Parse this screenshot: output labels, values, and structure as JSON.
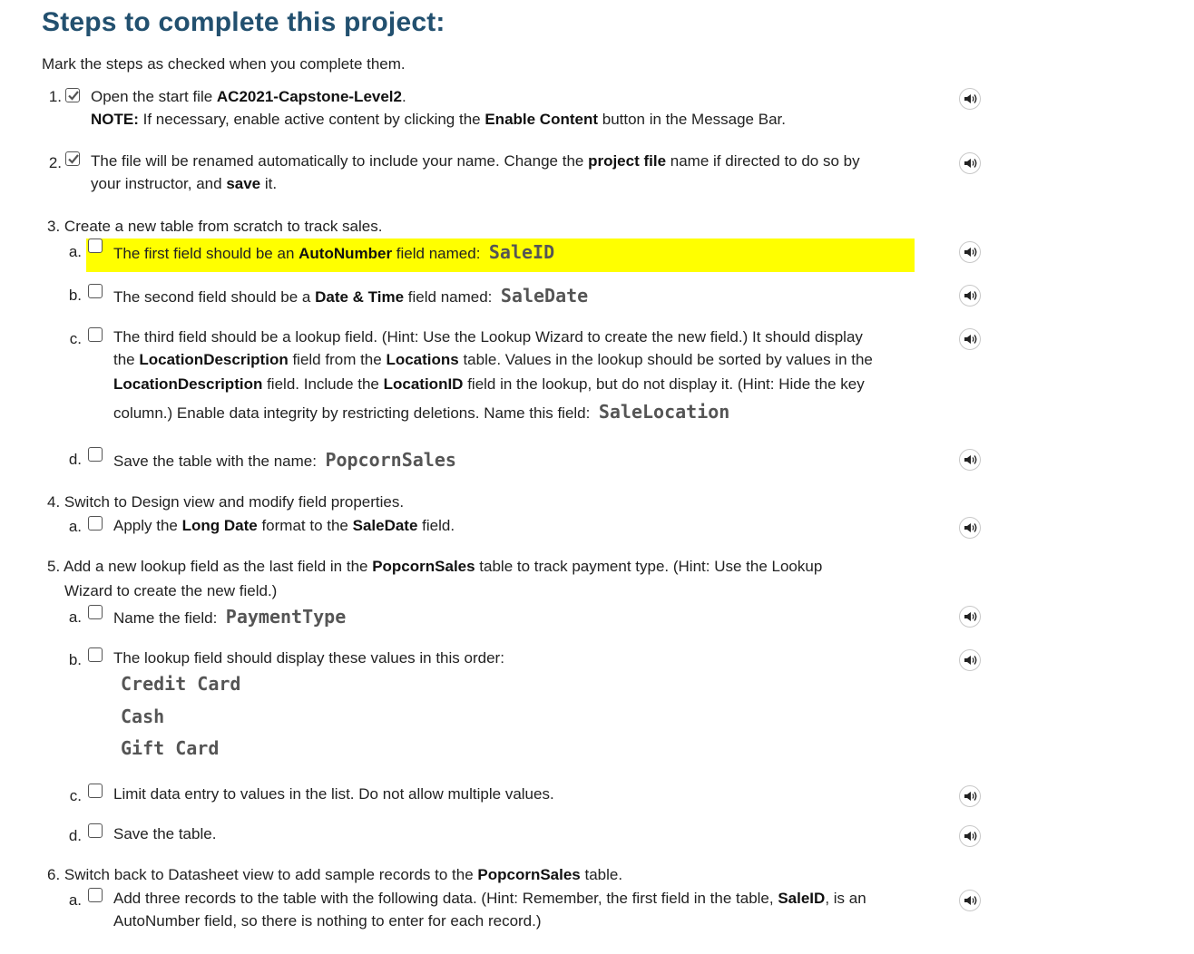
{
  "title": "Steps to complete this project:",
  "intro": "Mark the steps as checked when you complete them.",
  "colors": {
    "title": "#22506f",
    "highlight": "#ffff00",
    "mono": "#555555"
  },
  "step1": {
    "num": "1.",
    "t1": "Open the start file ",
    "b1": "AC2021-Capstone-Level2",
    "t2": ".",
    "note_label": "NOTE:",
    "note1": " If necessary, enable active content by clicking the ",
    "note_b": "Enable Content",
    "note2": " button in the Message Bar."
  },
  "step2": {
    "num": "2.",
    "t1": "The file will be renamed automatically to include your name. Change the ",
    "b1": "project file",
    "t2": " name if directed to do so by",
    "t3": "your instructor, and ",
    "b2": "save",
    "t4": " it."
  },
  "step3": {
    "num": "3.",
    "text": "Create a new table from scratch to track sales.",
    "a": {
      "letter": "a.",
      "t1": "The first field should be an ",
      "b1": "AutoNumber",
      "t2": " field named:",
      "code": "SaleID"
    },
    "b": {
      "letter": "b.",
      "t1": "The second field should be a ",
      "b1": "Date & Time",
      "t2": " field named:",
      "code": "SaleDate"
    },
    "c": {
      "letter": "c.",
      "l1": "The third field should be a lookup field. (Hint: Use the Lookup Wizard to create the new field.) It should display",
      "l2a": "the ",
      "l2b": "LocationDescription",
      "l2c": " field from the ",
      "l2d": "Locations",
      "l2e": " table. Values in the lookup should be sorted by values in the",
      "l3a": "LocationDescription",
      "l3b": " field. Include the ",
      "l3c": "LocationID",
      "l3d": " field in the lookup, but do not display it. (Hint: Hide the key",
      "l4": "column.) Enable data integrity by restricting deletions. Name this field:",
      "code": "SaleLocation"
    },
    "d": {
      "letter": "d.",
      "t1": "Save the table with the name:",
      "code": "PopcornSales"
    }
  },
  "step4": {
    "num": "4.",
    "text": "Switch to Design view and modify field properties.",
    "a": {
      "letter": "a.",
      "t1": "Apply the ",
      "b1": "Long Date",
      "t2": " format to the ",
      "b2": "SaleDate",
      "t3": " field."
    }
  },
  "step5": {
    "num": "5.",
    "t1": "Add a new lookup field as the last field in the ",
    "b1": "PopcornSales",
    "t2": " table to track payment type. (Hint: Use the Lookup",
    "t3": "Wizard to create the new field.)",
    "a": {
      "letter": "a.",
      "t1": "Name the field:",
      "code": "PaymentType"
    },
    "b": {
      "letter": "b.",
      "t1": "The lookup field should display these values in this order:",
      "values": [
        "Credit Card",
        "Cash",
        "Gift Card"
      ]
    },
    "c": {
      "letter": "c.",
      "t1": "Limit data entry to values in the list. Do not allow multiple values."
    },
    "d": {
      "letter": "d.",
      "t1": "Save the table."
    }
  },
  "step6": {
    "num": "6.",
    "t1": "Switch back to Datasheet view to add sample records to the ",
    "b1": "PopcornSales",
    "t2": " table.",
    "a": {
      "letter": "a.",
      "t1": "Add three records to the table with the following data. (Hint: Remember, the first field in the table, ",
      "b1": "SaleID",
      "t2": ", is an",
      "t3": "AutoNumber field, so there is nothing to enter for each record.)"
    }
  },
  "checkboxes": {
    "step1": true,
    "step2": true,
    "step3a": false,
    "step3b": false,
    "step3c": false,
    "step3d": false,
    "step4a": false,
    "step5a": false,
    "step5b": false,
    "step5c": false,
    "step5d": false,
    "step6a": false
  },
  "icons": {
    "checkbox_checked": "checkmark-icon",
    "audio": "speaker-icon"
  }
}
